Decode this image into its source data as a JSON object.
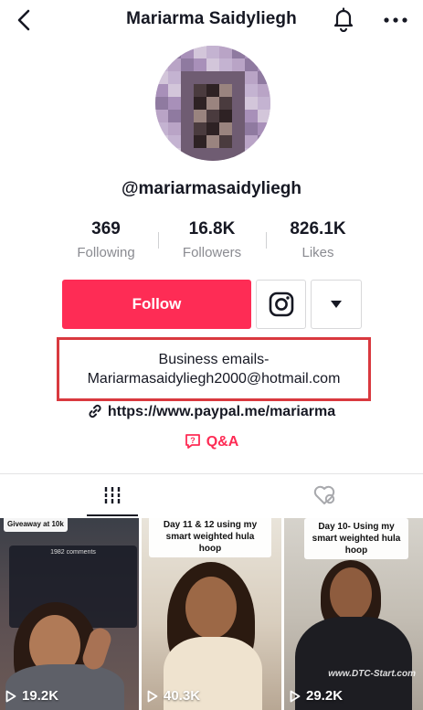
{
  "header": {
    "title": "Mariarma Saidyliegh",
    "icons": [
      "back-arrow-icon",
      "bell-icon",
      "more-dots-icon"
    ]
  },
  "profile": {
    "handle": "@mariarmasaidyliegh"
  },
  "stats": [
    {
      "value": "369",
      "label": "Following"
    },
    {
      "value": "16.8K",
      "label": "Followers"
    },
    {
      "value": "826.1K",
      "label": "Likes"
    }
  ],
  "actions": {
    "follow_label": "Follow",
    "instagram_icon": "instagram-icon",
    "dropdown_icon": "caret-down-icon"
  },
  "bio": {
    "line1": "Business emails-",
    "line2": "Mariarmasaidyliegh2000@hotmail.com",
    "link": "https://www.paypal.me/mariarma",
    "qa_label": "Q&A"
  },
  "tabs": [
    {
      "name": "videos",
      "icon": "grid-icon"
    },
    {
      "name": "liked",
      "icon": "liked-heart-icon"
    }
  ],
  "videos": [
    {
      "views": "19.2K",
      "caption": "Giveaway at 10k",
      "overlay": "1982 comments"
    },
    {
      "views": "40.3K",
      "caption": "Day 11 & 12 using my smart weighted hula hoop"
    },
    {
      "views": "29.2K",
      "caption": "Day 10- Using my smart weighted hula hoop",
      "watermark": "www.DTC-Start.com"
    }
  ],
  "colors": {
    "accent": "#fe2c55",
    "highlight_border": "#d9393f",
    "muted_text": "#8a8b91"
  }
}
